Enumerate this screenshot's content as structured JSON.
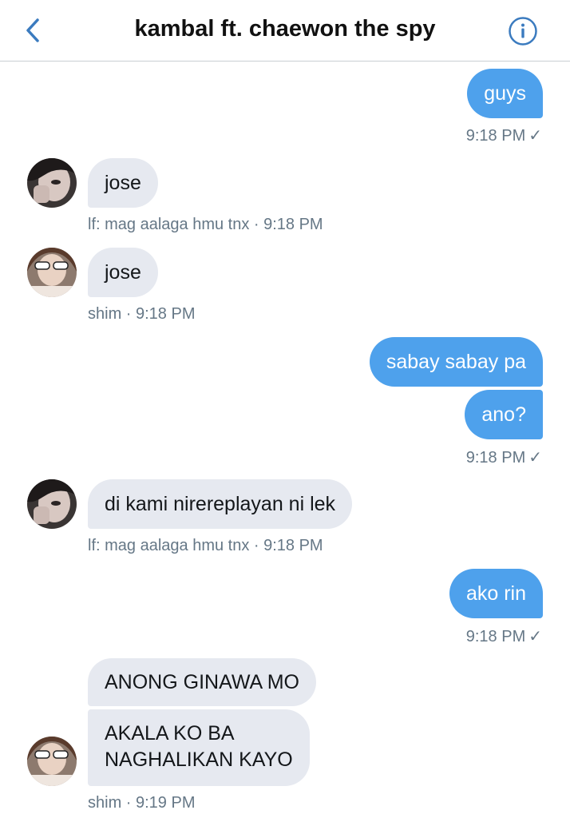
{
  "header": {
    "title": "kambal ft. chaewon the spy",
    "back_icon": "chevron-left-icon",
    "info_icon": "info-icon",
    "accent": "#3b7bbf"
  },
  "colors": {
    "outgoing_bubble": "#4ea1ec",
    "incoming_bubble": "#e6e9f0",
    "meta_text": "#657786"
  },
  "messages": [
    {
      "text": "guys",
      "meta": "9:18 PM",
      "check": "✓"
    },
    {
      "text": "jose",
      "meta": "lf: mag aalaga hmu tnx · 9:18 PM"
    },
    {
      "text": "jose",
      "meta": "shim · 9:18 PM"
    },
    {
      "text": "sabay sabay pa"
    },
    {
      "text": "ano?",
      "meta": "9:18 PM",
      "check": "✓"
    },
    {
      "text": "di kami nirereplayan ni lek",
      "meta": "lf: mag aalaga hmu tnx · 9:18 PM"
    },
    {
      "text": "ako rin",
      "meta": "9:18 PM",
      "check": "✓"
    },
    {
      "text": "ANONG GINAWA MO"
    },
    {
      "text_line1": "AKALA KO BA",
      "text_line2": "NAGHALIKAN KAYO",
      "meta": "shim · 9:19 PM"
    }
  ]
}
